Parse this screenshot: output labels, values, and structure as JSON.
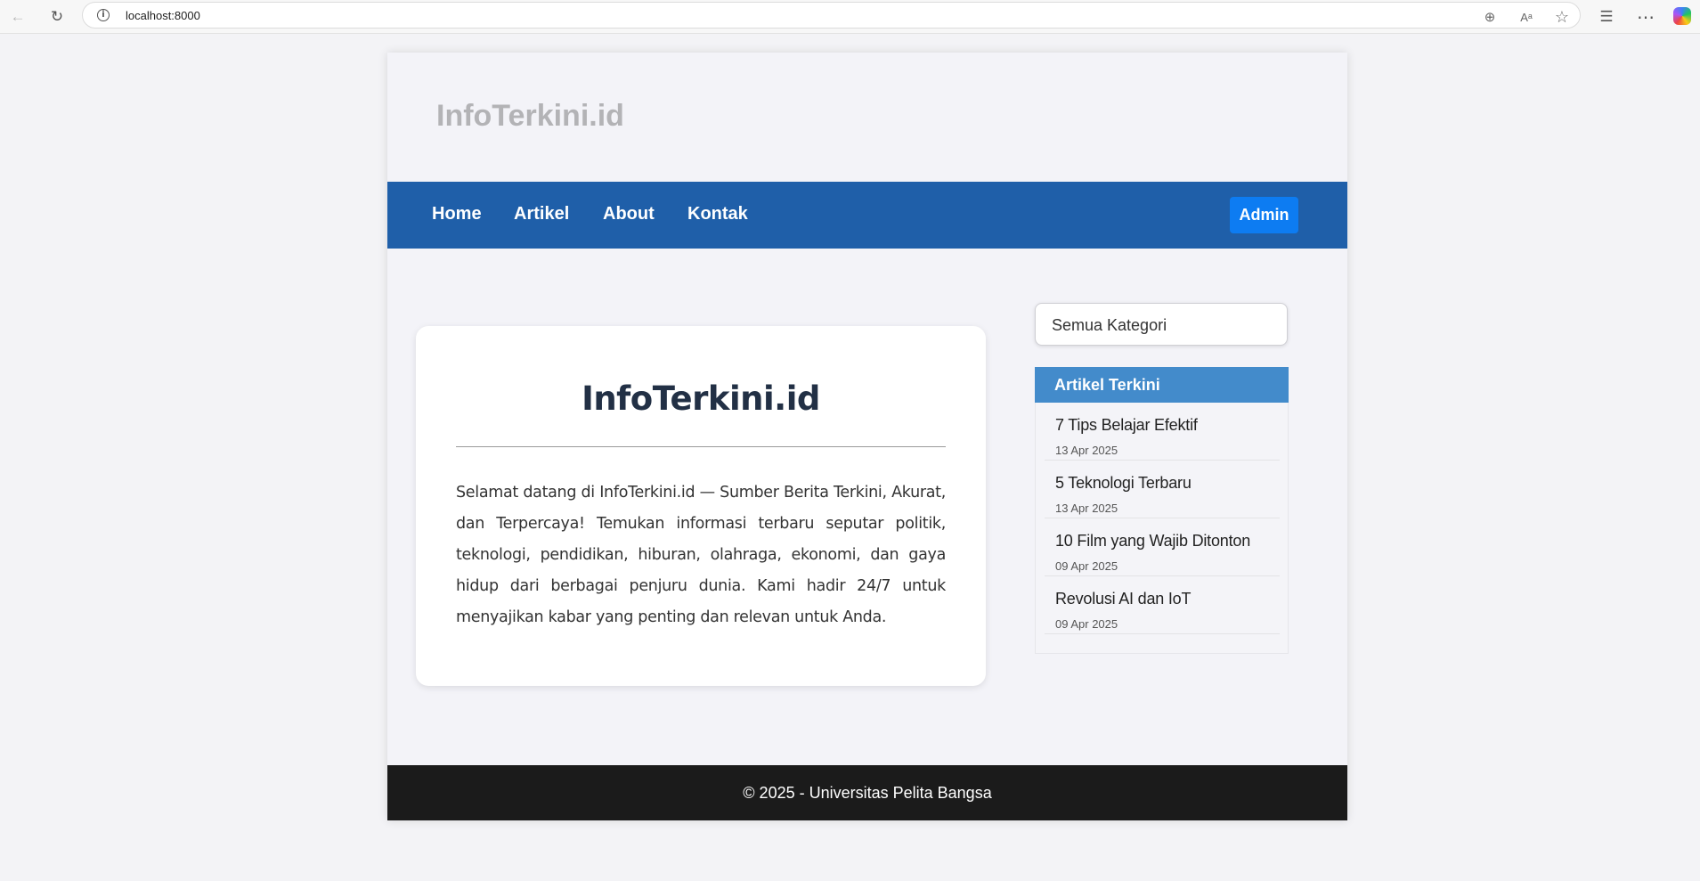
{
  "browser": {
    "url": "localhost:8000",
    "info_glyph": "i",
    "icons": {
      "back": "back-arrow-icon",
      "refresh": "refresh-icon",
      "zoom": "zoom-in-icon",
      "read_aloud": "read-aloud-icon",
      "favorite": "star-icon",
      "favorites": "favorites-list-icon",
      "more": "more-icon",
      "copilot": "copilot-icon"
    },
    "glyphs": {
      "back": "←",
      "refresh": "↻",
      "zoom": "⊕",
      "read_aloud": "Aᵃ",
      "favorite": "☆",
      "favorites": "☰",
      "more": "⋯"
    }
  },
  "header": {
    "logo": "InfoTerkini.id"
  },
  "nav": {
    "items": [
      {
        "label": "Home"
      },
      {
        "label": "Artikel"
      },
      {
        "label": "About"
      },
      {
        "label": "Kontak"
      }
    ],
    "admin_label": "Admin"
  },
  "main": {
    "title": "InfoTerkini.id",
    "body": "Selamat datang di InfoTerkini.id — Sumber Berita Terkini, Akurat, dan Terpercaya! Temukan informasi terbaru seputar politik, teknologi, pendidikan, hiburan, olahraga, ekonomi, dan gaya hidup dari berbagai penjuru dunia. Kami hadir 24/7 untuk menyajikan kabar yang penting dan relevan untuk Anda."
  },
  "sidebar": {
    "category_selected": "Semua Kategori",
    "recent_title": "Artikel Terkini",
    "articles": [
      {
        "title": "7 Tips Belajar Efektif",
        "date": "13 Apr 2025"
      },
      {
        "title": "5 Teknologi Terbaru",
        "date": "13 Apr 2025"
      },
      {
        "title": "10 Film yang Wajib Ditonton",
        "date": "09 Apr 2025"
      },
      {
        "title": "Revolusi AI dan IoT",
        "date": "09 Apr 2025"
      }
    ]
  },
  "footer": {
    "text": "© 2025 - Universitas Pelita Bangsa"
  },
  "colors": {
    "navbar": "#1f5fa9",
    "admin_button": "#0d7cf2",
    "sidebar_header": "#438bcb",
    "footer": "#1b1b1b"
  }
}
